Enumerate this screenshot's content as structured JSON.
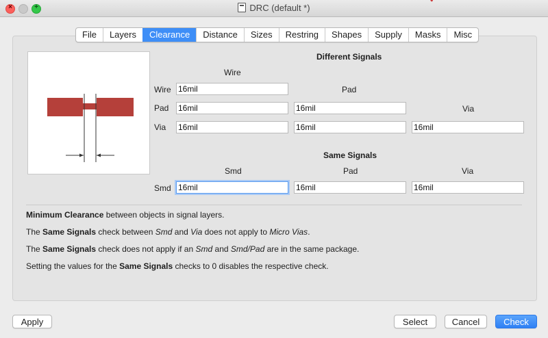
{
  "window": {
    "title": "DRC (default *)"
  },
  "tabs": [
    "File",
    "Layers",
    "Clearance",
    "Distance",
    "Sizes",
    "Restring",
    "Shapes",
    "Supply",
    "Masks",
    "Misc"
  ],
  "active_tab": "Clearance",
  "different_signals": {
    "heading": "Different Signals",
    "col_wire": "Wire",
    "col_pad": "Pad",
    "col_via": "Via",
    "row_wire": "Wire",
    "row_pad": "Pad",
    "row_via": "Via",
    "wire_wire": "16mil",
    "pad_wire": "16mil",
    "pad_pad": "16mil",
    "via_wire": "16mil",
    "via_pad": "16mil",
    "via_via": "16mil"
  },
  "same_signals": {
    "heading": "Same Signals",
    "col_smd": "Smd",
    "col_pad": "Pad",
    "col_via": "Via",
    "row_smd": "Smd",
    "smd_smd": "16mil",
    "smd_pad": "16mil",
    "smd_via": "16mil"
  },
  "notes": {
    "n1_bold": "Minimum Clearance",
    "n1_rest": " between objects in signal layers.",
    "n2_a": "The ",
    "n2_bold": "Same Signals",
    "n2_b": " check between ",
    "n2_i1": "Smd",
    "n2_c": " and ",
    "n2_i2": "Via",
    "n2_d": " does not apply to ",
    "n2_i3": "Micro Vias",
    "n2_e": ".",
    "n3_a": "The ",
    "n3_bold": "Same Signals",
    "n3_b": " check does not apply if an ",
    "n3_i1": "Smd",
    "n3_c": " and ",
    "n3_i2": "Smd/Pad",
    "n3_d": " are in the same package.",
    "n4_a": "Setting the values for the ",
    "n4_bold": "Same Signals",
    "n4_b": " checks to 0 disables the respective check."
  },
  "buttons": {
    "apply": "Apply",
    "select": "Select",
    "cancel": "Cancel",
    "check": "Check"
  },
  "colors": {
    "accent": "#3e8ef7",
    "wire_fill": "#b5403a"
  },
  "icons": {
    "close": "close-icon",
    "minimize": "minimize-icon",
    "maximize": "maximize-icon",
    "document": "document-icon"
  }
}
